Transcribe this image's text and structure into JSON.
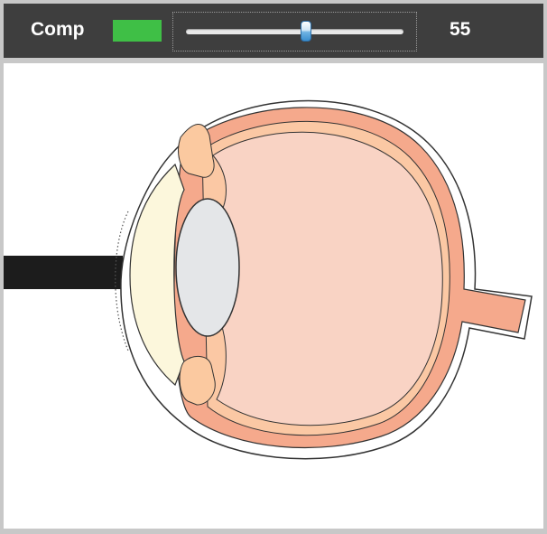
{
  "toolbar": {
    "comp_label": "Comp",
    "swatch_color": "#3fbf46",
    "slider": {
      "min": 0,
      "max": 100,
      "value": 55
    },
    "value_text": "55"
  },
  "diagram": {
    "colors": {
      "sclera": "#f5a98c",
      "choroid": "#fbc8a4",
      "vitreous": "#f9d3c4",
      "cornea": "#fcf7dc",
      "lens": "#e4e6e8",
      "ciliary": "#fbc9a0",
      "stop_bar": "#1c1c1c",
      "outline": "#333333"
    }
  }
}
